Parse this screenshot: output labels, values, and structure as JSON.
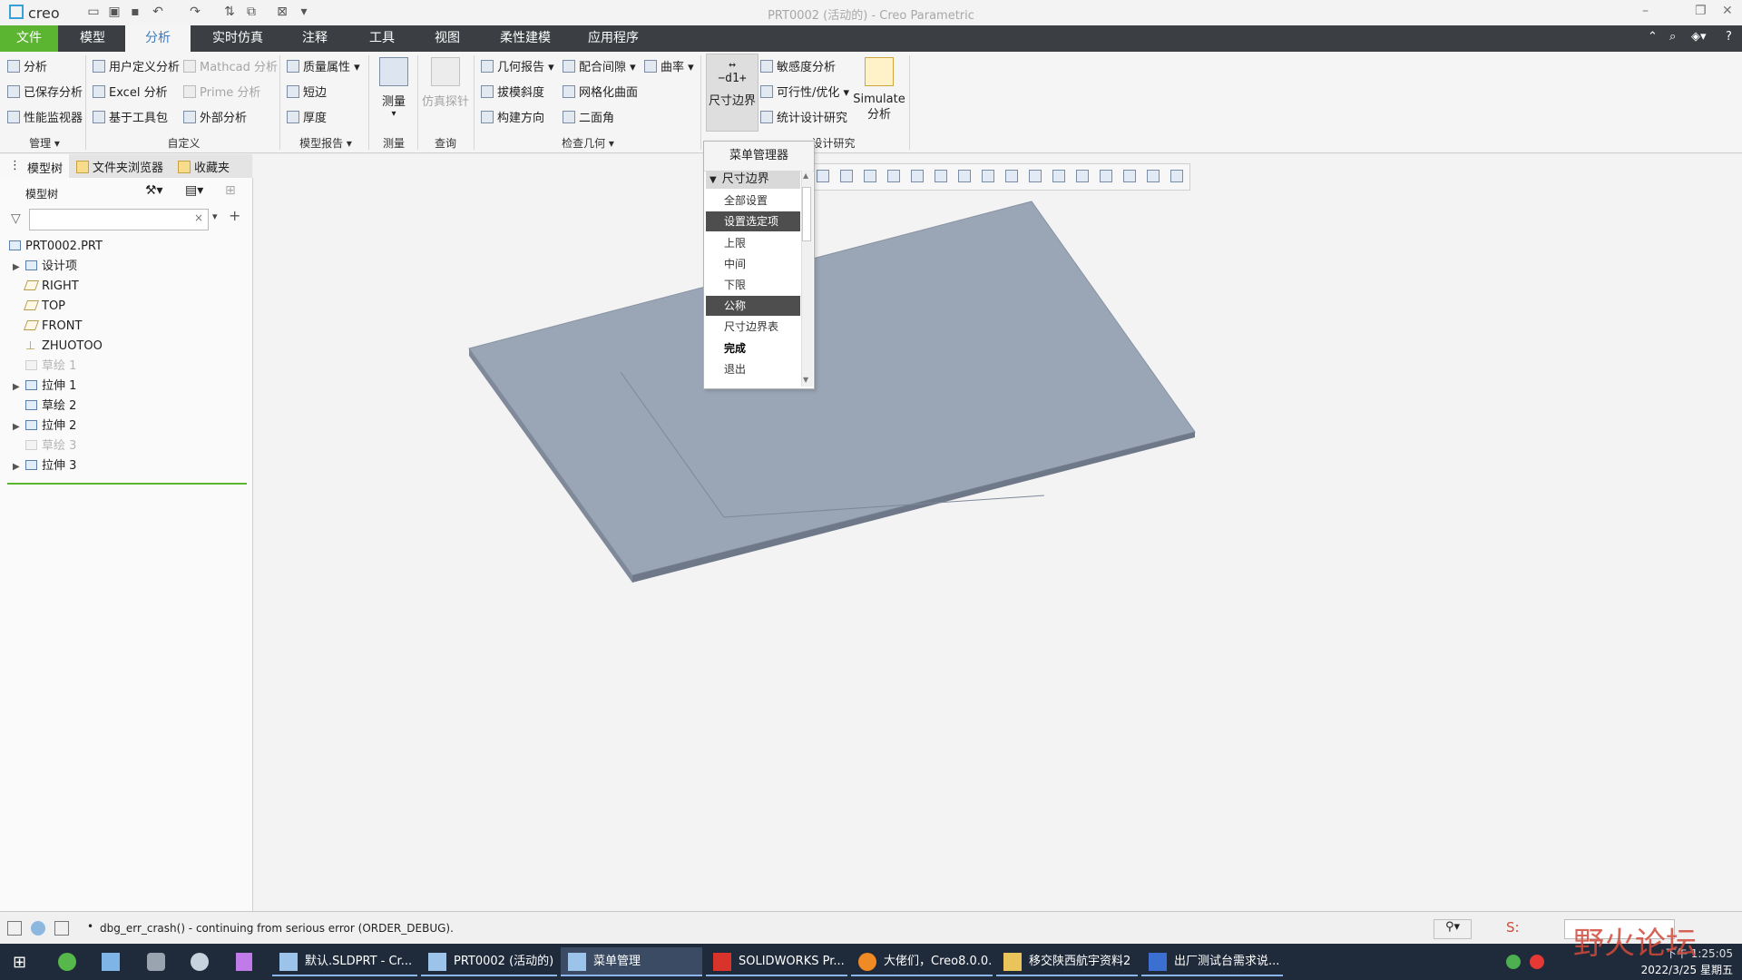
{
  "titlebar": {
    "logo": "creo",
    "window_title": "PRT0002 (活动的) - Creo Parametric",
    "controls": [
      "–",
      "❐",
      "✕"
    ]
  },
  "ribbon_tabs": [
    "文件",
    "模型",
    "分析",
    "实时仿真",
    "注释",
    "工具",
    "视图",
    "柔性建模",
    "应用程序"
  ],
  "active_tab": "分析",
  "ribbon": {
    "manage": {
      "items": [
        "分析",
        "已保存分析",
        "性能监视器"
      ],
      "label": "管理 ▾"
    },
    "custom": {
      "items": [
        "用户定义分析",
        "Excel 分析",
        "基于工具包",
        "Mathcad 分析",
        "Prime 分析",
        "外部分析"
      ],
      "label": "自定义"
    },
    "model_report": {
      "items": [
        "质量属性 ▾",
        "短边",
        "厚度"
      ],
      "label": "模型报告 ▾"
    },
    "measure": {
      "button": "测量",
      "label": "测量"
    },
    "query": {
      "button": "仿真探针",
      "label": "查询"
    },
    "inspect": {
      "items": [
        "几何报告 ▾",
        "拔模斜度",
        "构建方向",
        "配合间隙 ▾",
        "网格化曲面",
        "二面角",
        "曲率 ▾"
      ],
      "label": "检查几何 ▾"
    },
    "design_study": {
      "dim_button": "尺寸边界",
      "items": [
        "敏感度分析",
        "可行性/优化 ▾",
        "统计设计研究"
      ],
      "simulate": "Simulate 分析",
      "label": "设计研究"
    }
  },
  "panel_tabs": [
    "模型树",
    "文件夹浏览器",
    "收藏夹"
  ],
  "model_tree": {
    "header": "模型树",
    "search_placeholder": "",
    "nodes": [
      {
        "label": "PRT0002.PRT",
        "expander": "",
        "dim": false
      },
      {
        "label": "设计项",
        "expander": "▶",
        "dim": false
      },
      {
        "label": "RIGHT",
        "expander": "",
        "dim": false
      },
      {
        "label": "TOP",
        "expander": "",
        "dim": false
      },
      {
        "label": "FRONT",
        "expander": "",
        "dim": false
      },
      {
        "label": "ZHUOTOO",
        "expander": "",
        "dim": false
      },
      {
        "label": "草绘 1",
        "expander": "",
        "dim": true
      },
      {
        "label": "拉伸 1",
        "expander": "▶",
        "dim": false
      },
      {
        "label": "草绘 2",
        "expander": "",
        "dim": false
      },
      {
        "label": "拉伸 2",
        "expander": "▶",
        "dim": false
      },
      {
        "label": "草绘 3",
        "expander": "",
        "dim": true
      },
      {
        "label": "拉伸 3",
        "expander": "▶",
        "dim": false
      }
    ]
  },
  "menu_manager": {
    "title": "菜单管理器",
    "header": "尺寸边界",
    "items": [
      "全部设置",
      "设置选定项",
      "上限",
      "中间",
      "下限",
      "公称",
      "尺寸边界表",
      "完成",
      "退出"
    ]
  },
  "status": {
    "message": "dbg_err_crash() - continuing from serious error (ORDER_DEBUG)."
  },
  "taskbar": {
    "apps": [
      "默认.SLDPRT - Cr...",
      "PRT0002 (活动的) ...",
      "菜单管理",
      "SOLIDWORKS Pr...",
      "大佬们，Creo8.0.0...",
      "移交陕西航宇资料2",
      "出厂测试台需求说..."
    ],
    "time": "下午 1:25:05",
    "date": "2022/3/25 星期五"
  },
  "watermark": "野火论坛",
  "colors": {
    "file_tab": "#5cb531",
    "tab_bar": "#3b3f43",
    "active_tab_text": "#3c7bc0",
    "part_fill": "#9aa6b5",
    "taskbar": "#1f2a3a"
  }
}
